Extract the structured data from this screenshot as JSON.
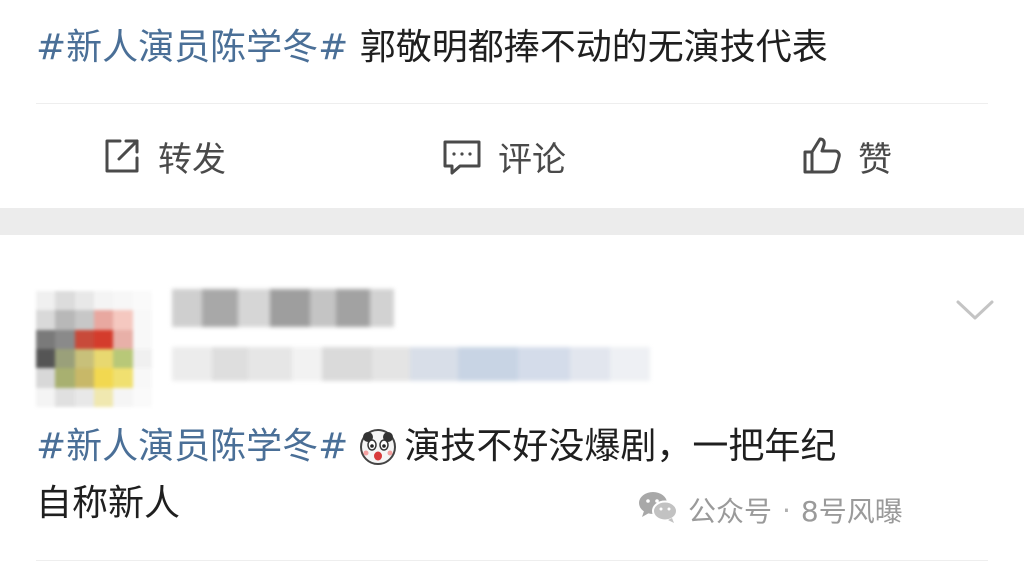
{
  "post": {
    "hashtag": "#新人演员陈学冬#",
    "text": "郭敬明都捧不动的无演技代表"
  },
  "actions": {
    "repost_icon": "share-icon",
    "repost_label": "转发",
    "comment_icon": "comment-icon",
    "comment_label": "评论",
    "like_icon": "thumbs-up-icon",
    "like_label": "赞"
  },
  "comment": {
    "hashtag": "#新人演员陈学冬#",
    "emoji": "shocked-face-emoji",
    "line1_text": "演技不好没爆剧，一把年纪",
    "line2_text": "自称新人",
    "expand_icon": "chevron-down-icon"
  },
  "watermark": {
    "icon": "wechat-icon",
    "source": "公众号",
    "separator": "·",
    "account": "8号风曝"
  },
  "colors": {
    "hashtag": "#4a6f97",
    "text": "#1f1f1f",
    "action": "#4a4a4a",
    "separator_band": "#ececec",
    "watermark": "#9a9a9a"
  }
}
